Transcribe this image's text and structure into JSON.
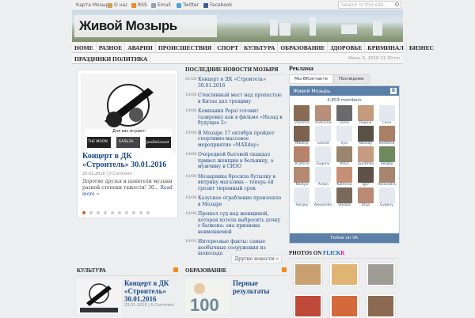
{
  "topbar": {
    "links": [
      {
        "label": "Карта Мозыря"
      },
      {
        "label": "О нас"
      },
      {
        "label": "RSS"
      },
      {
        "label": "Email"
      },
      {
        "label": "Twitter"
      },
      {
        "label": "Facebook"
      }
    ],
    "search_placeholder": "Search in this site..."
  },
  "header": {
    "site_title": "Живой Мозырь"
  },
  "nav": {
    "row1": [
      "Home",
      "Разное",
      "Аварии",
      "Происшествия",
      "Спорт",
      "Культура",
      "Образование",
      "Здоровье",
      "Криминал",
      "Бизнес"
    ],
    "row2": [
      "Праздники",
      "Политика"
    ],
    "date": "Июнь 6, 2016 11:30 пп"
  },
  "slider": {
    "title": "Концерт в ДК «Строитель» 30.01.2016",
    "date": "20.01.2016",
    "comments": "0 Comment",
    "excerpt": "Дорогие друзья и ценители музыки разной степени тяжести! 30...",
    "read_more": "Read more »",
    "poster_text": [
      "Для вас играют:",
      "THE MOON",
      "БАЛЬЗА",
      "JazzDeGround"
    ]
  },
  "latest": {
    "title": "Последние новости Мозыря",
    "items": [
      {
        "date": "01/20",
        "text": "Концерт в ДК «Строитель» 30.01.2016"
      },
      {
        "date": "10/08",
        "text": "Стеклянный мост над пропастью в Китае дал трещину"
      },
      {
        "date": "10/08",
        "text": "Компания Pepsi готовит газировку как в фильме «Назад в будущее 2»"
      },
      {
        "date": "10/08",
        "text": "В Мозыре 17 октября пройдет спортивно-массовое мероприятие «МАХday»"
      },
      {
        "date": "10/08",
        "text": "Очередной бытовой скандал привел женщин в больницу, а мужчину в СИЗО"
      },
      {
        "date": "10/08",
        "text": "Мозырянка бросила бутылку в витрину магазина – теперь ей грозит тюремный срок"
      },
      {
        "date": "10/08",
        "text": "Казусное ограбление произошло в Мозыре"
      },
      {
        "date": "10/06",
        "text": "Прошел суд над женщиной, которая хотела выбросить дочку с балкона: она признана невменяемой"
      },
      {
        "date": "10/03",
        "text": "Интересные факты: самые необычные сооружения из шоколада"
      }
    ],
    "more": "Другие новости »"
  },
  "sidebar": {
    "ad_title": "Реклама",
    "tabs": [
      "Мы ВКонтакте",
      "Последнее"
    ],
    "vk": {
      "group": "Живой Мозырь",
      "members": "4,859 members",
      "follow": "Follow on VK",
      "people": [
        {
          "name": "Vladimir",
          "color": "#8a6c55"
        },
        {
          "name": "Antonina",
          "color": "#b88f78"
        },
        {
          "name": "Dima",
          "color": "#6a6a6a"
        },
        {
          "name": "Regina",
          "color": "#c49a7c"
        },
        {
          "name": "Lena",
          "color": "#e2e8ee"
        },
        {
          "name": "Nikolay",
          "color": "#7d6250"
        },
        {
          "name": "Leonid",
          "color": "#e4e9ef"
        },
        {
          "name": "Ilya",
          "color": "#e4e9ef"
        },
        {
          "name": "Nikolay",
          "color": "#5a5046"
        },
        {
          "name": "Svetlana",
          "color": "#a97f66"
        },
        {
          "name": "Kristina",
          "color": "#b6836c"
        },
        {
          "name": "Evgeny",
          "color": "#e4e9ef"
        },
        {
          "name": "Artur",
          "color": "#9a8571"
        },
        {
          "name": "Lyudmila",
          "color": "#c59c82"
        },
        {
          "name": "Sergey",
          "color": "#6f8a5c"
        },
        {
          "name": "Nastya",
          "color": "#b48a73"
        },
        {
          "name": "Anton",
          "color": "#e4e9ef"
        },
        {
          "name": "Katerina",
          "color": "#c78f76"
        },
        {
          "name": "Igor",
          "color": "#5e5148"
        },
        {
          "name": "Alexandra",
          "color": "#a6866e"
        },
        {
          "name": "Sergey",
          "color": "#e4e9ef"
        },
        {
          "name": "Alexander",
          "color": "#e4e9ef"
        },
        {
          "name": "Styopa",
          "color": "#7a6a5c"
        },
        {
          "name": "Olya",
          "color": "#b98b74"
        },
        {
          "name": "Evgeny",
          "color": "#e4e9ef"
        }
      ]
    },
    "flickr_title_pre": "Photos on ",
    "flickr_title_a": "flick",
    "flickr_title_b": "r",
    "flickr_colors": [
      "#c9a070",
      "#e0b472",
      "#9c9c94",
      "#c04a3a",
      "#d46a3c",
      "#8c6a52"
    ]
  },
  "categories": [
    {
      "head": "Культура",
      "title": "Концерт в ДК «Строитель» 30.01.2016",
      "date": "20.01.2016",
      "comments": "0 Comment"
    },
    {
      "head": "Образование",
      "title": "Первые результаты",
      "date": "",
      "comments": ""
    }
  ],
  "colors": {
    "accent": "#1a4a8a",
    "vk": "#5b7fa6",
    "rss": "#f28a1c"
  }
}
